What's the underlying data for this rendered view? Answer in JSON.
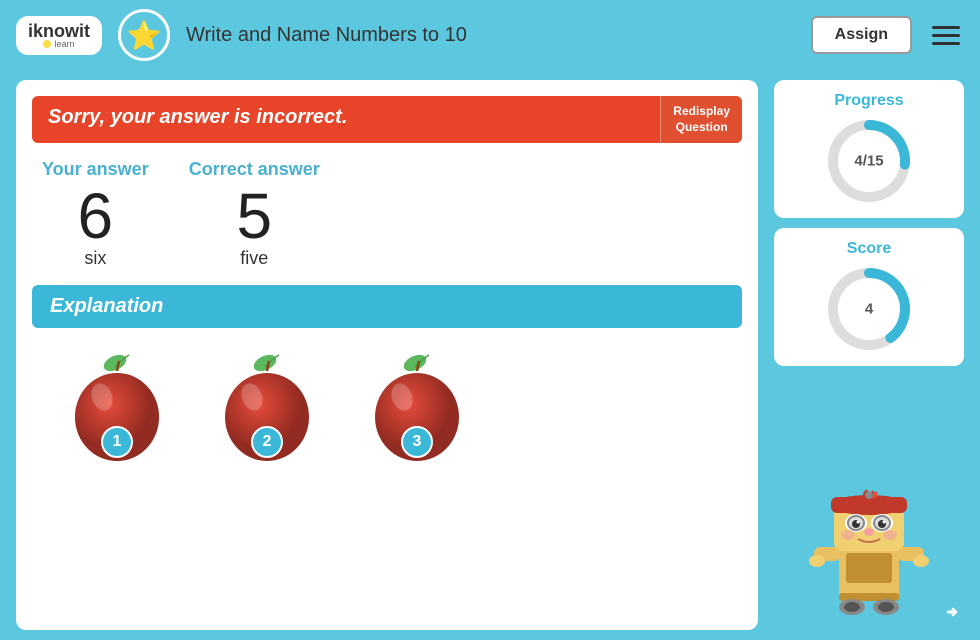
{
  "header": {
    "logo_text": "iknowit",
    "logo_tagline": "learn",
    "star_icon": "⭐",
    "title": "Write and Name Numbers to 10",
    "assign_label": "Assign",
    "hamburger_icon": "menu"
  },
  "content": {
    "incorrect_banner": {
      "text": "Sorry, your answer is incorrect.",
      "redisplay_line1": "Redisplay",
      "redisplay_line2": "Question"
    },
    "your_answer_label": "Your answer",
    "correct_answer_label": "Correct answer",
    "your_answer_number": "6",
    "your_answer_word": "six",
    "correct_answer_number": "5",
    "correct_answer_word": "five",
    "explanation_label": "Explanation",
    "apples": [
      {
        "number": "1"
      },
      {
        "number": "2"
      },
      {
        "number": "3"
      }
    ]
  },
  "sidebar": {
    "progress_label": "Progress",
    "progress_value": "4/15",
    "progress_numerator": 4,
    "progress_denominator": 15,
    "score_label": "Score",
    "score_value": "4",
    "score_percent": 40
  },
  "colors": {
    "accent": "#3bb8d8",
    "error": "#e8442a",
    "progress_arc": "#3bb8d8",
    "bg_arc": "#dddddd"
  }
}
